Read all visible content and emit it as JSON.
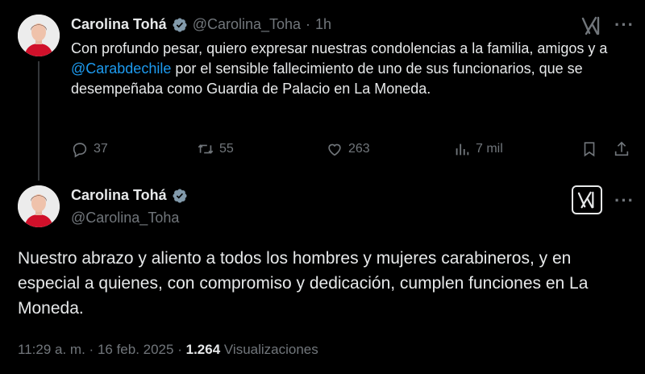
{
  "tweet1": {
    "author_name": "Carolina Tohá",
    "handle": "@Carolina_Toha",
    "separator": "·",
    "time": "1h",
    "text_before": "Con profundo pesar, quiero expresar nuestras condolencias a la familia, amigos y a ",
    "mention": "@Carabdechile",
    "text_after": " por el sensible fallecimiento de uno de sus funcionarios, que se desempeñaba como Guardia de Palacio en La Moneda.",
    "replies": "37",
    "reposts": "55",
    "likes": "263",
    "views": "7 mil",
    "more": "···"
  },
  "tweet2": {
    "author_name": "Carolina Tohá",
    "handle": "@Carolina_Toha",
    "text": "Nuestro abrazo y aliento a todos los hombres y mujeres carabineros, y en especial a quienes, con compromiso y dedicación, cumplen funciones en La Moneda.",
    "time": "11:29 a. m.",
    "separator": "·",
    "date": "16 feb. 2025",
    "separator2": "·",
    "view_count": "1.264",
    "view_label": "Visualizaciones",
    "more": "···"
  },
  "colors": {
    "background": "#000000",
    "text": "#e7e9ea",
    "muted": "#71767b",
    "link": "#1d9bf0",
    "verified": "#829aab"
  },
  "icons": [
    "verified-badge-icon",
    "grok-icon",
    "more-icon",
    "reply-icon",
    "repost-icon",
    "like-icon",
    "views-icon",
    "bookmark-icon",
    "share-icon"
  ]
}
